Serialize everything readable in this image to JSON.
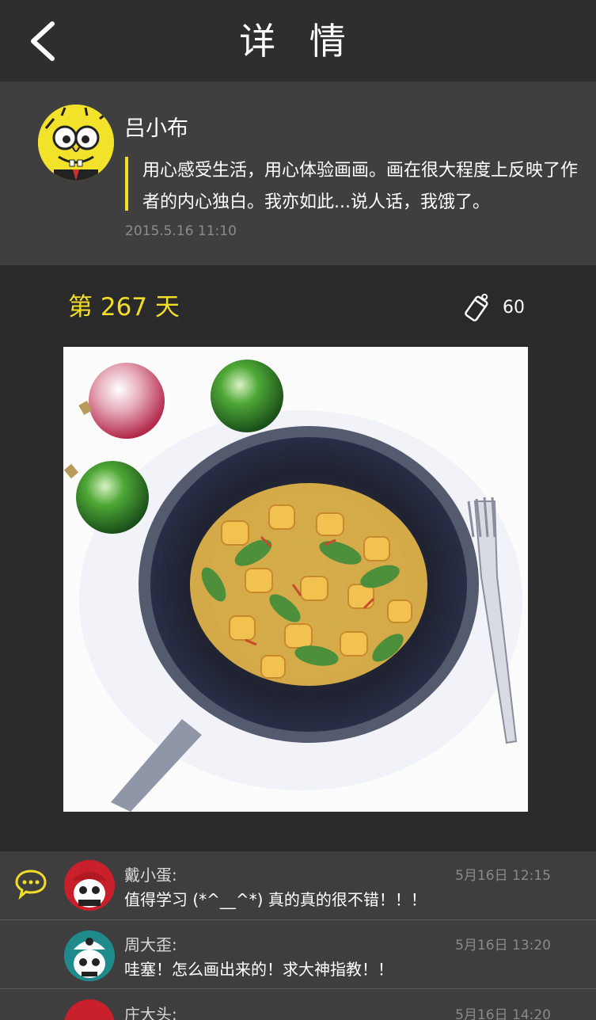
{
  "header": {
    "title": "详 情",
    "back_icon": "chevron-left-icon"
  },
  "author": {
    "name": "吕小布",
    "quote": "用心感受生活，用心体验画画。画在很大程度上反映了作者的内心独白。我亦如此...说人话，我饿了。",
    "time": "2015.5.16  11:10",
    "avatar_icon": "cartoon-avatar"
  },
  "post": {
    "day_label": "第 267 天",
    "like_icon": "thumb-tag-icon",
    "like_count": "60"
  },
  "colors": {
    "accent": "#f2de2a",
    "header_bg": "#2e2e2e",
    "panel_bg": "#3f3f3f",
    "page_bg": "#2a2a2a"
  },
  "comments": {
    "icon": "speech-bubble-icon",
    "items": [
      {
        "name": "戴小蛋:",
        "text": "值得学习   (*^__^*) 真的真的很不错！！！",
        "time": "5月16日 12:15"
      },
      {
        "name": "周大歪:",
        "text": "哇塞！怎么画出来的！求大神指教！！",
        "time": "5月16日 13:20"
      },
      {
        "name": "庄大头:",
        "text": "",
        "time": "5月16日 14:20"
      }
    ]
  }
}
